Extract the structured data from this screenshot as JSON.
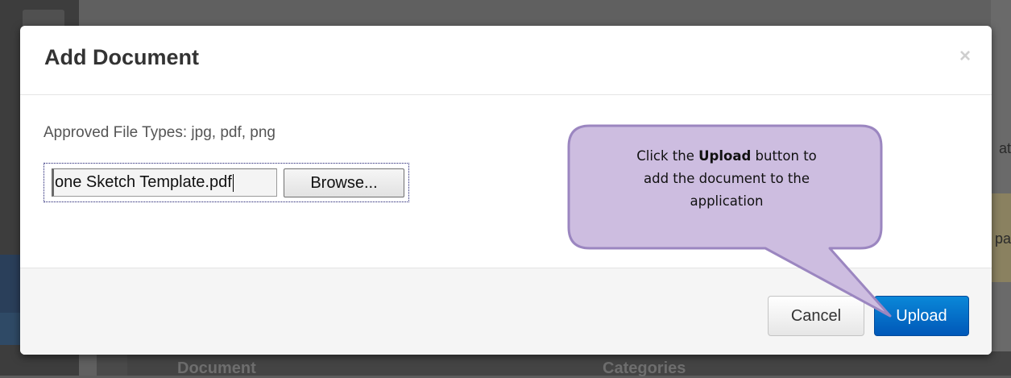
{
  "background": {
    "table_headers": [
      "Document",
      "Categories"
    ],
    "edge_fragments": [
      "at",
      "pa"
    ]
  },
  "dialog": {
    "title": "Add Document",
    "close_symbol": "×",
    "approved_types_text": "Approved File Types: jpg, pdf, png",
    "file_input": {
      "value": "one Sketch Template.pdf",
      "browse_label": "Browse..."
    },
    "buttons": {
      "cancel": "Cancel",
      "upload": "Upload"
    }
  },
  "callout": {
    "prefix": "Click the ",
    "emphasis": "Upload",
    "suffix_line1": " button to",
    "line2": "add the document to the",
    "line3": "application",
    "fill_color": "#cdbde0",
    "stroke_color": "#9b86c0"
  },
  "colors": {
    "upload_primary": "#0a6fcf",
    "overlay": "#5c5c5c"
  }
}
